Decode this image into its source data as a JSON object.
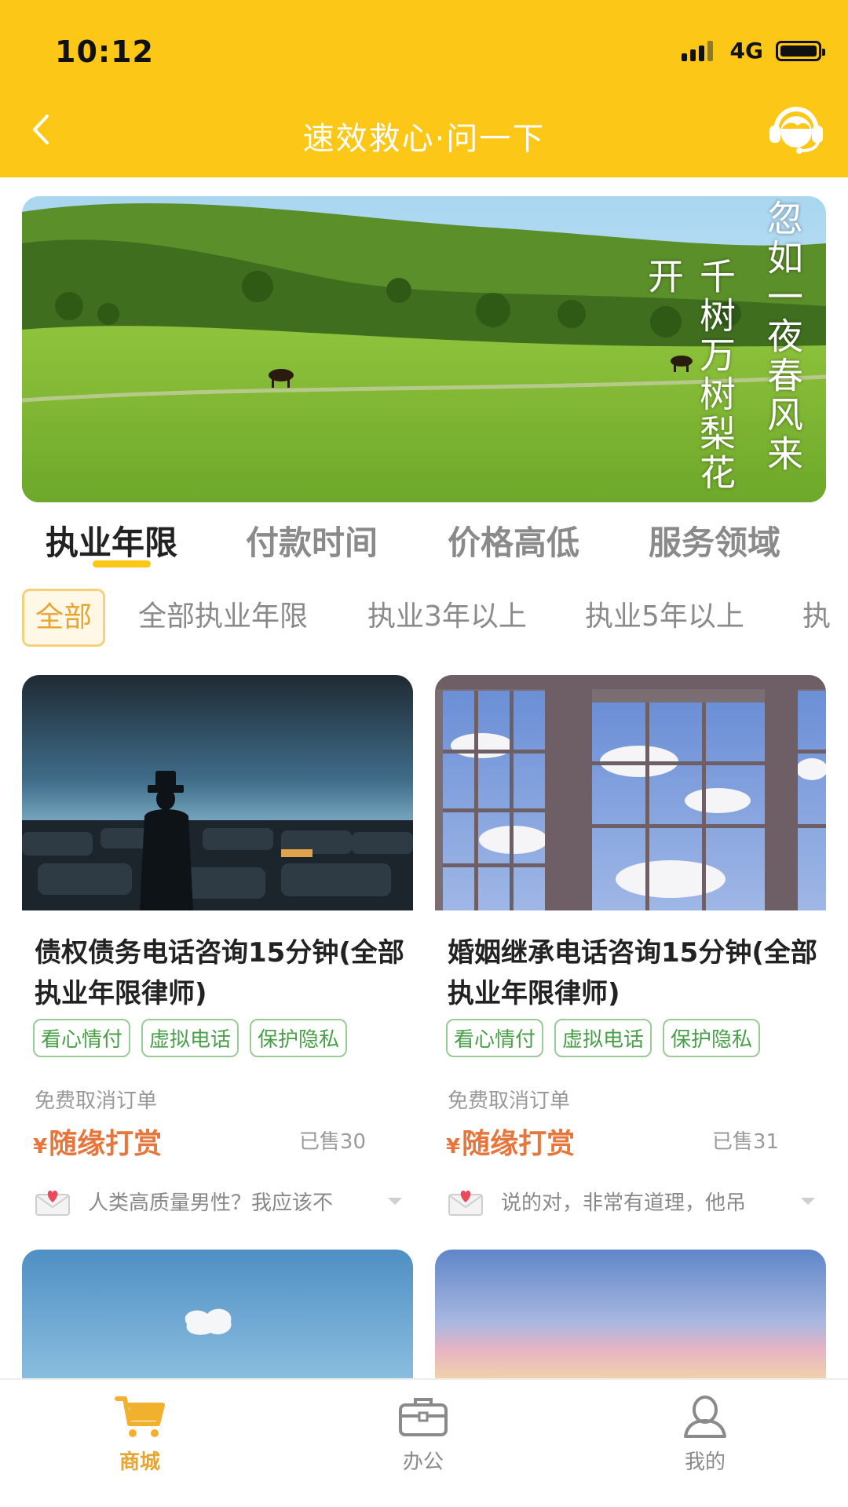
{
  "status_bar": {
    "time": "10:12",
    "network": "4G"
  },
  "header": {
    "title": "速效救心·问一下",
    "back_icon": "chevron-left-icon",
    "service_icon": "headset-icon"
  },
  "banner": {
    "poem_line_1": "忽如一夜春风来",
    "poem_line_2": "千树万树梨花开"
  },
  "sort_tabs": [
    {
      "label": "执业年限",
      "active": true
    },
    {
      "label": "付款时间",
      "active": false
    },
    {
      "label": "价格高低",
      "active": false
    },
    {
      "label": "服务领域",
      "active": false
    }
  ],
  "filters": [
    {
      "label": "全部",
      "active": true
    },
    {
      "label": "全部执业年限",
      "active": false
    },
    {
      "label": "执业3年以上",
      "active": false
    },
    {
      "label": "执业5年以上",
      "active": false
    },
    {
      "label": "执",
      "active": false
    }
  ],
  "products": [
    {
      "title": "债权债务电话咨询15分钟(全部执业年限律师)",
      "tags": [
        "看心情付",
        "虚拟电话",
        "保护隐私"
      ],
      "note": "免费取消订单",
      "currency": "¥",
      "price_text": "随缘打赏",
      "sold": "已售30",
      "review": "人类高质量男性？我应该不"
    },
    {
      "title": "婚姻继承电话咨询15分钟(全部执业年限律师)",
      "tags": [
        "看心情付",
        "虚拟电话",
        "保护隐私"
      ],
      "note": "免费取消订单",
      "currency": "¥",
      "price_text": "随缘打赏",
      "sold": "已售31",
      "review": "说的对，非常有道理，他吊"
    }
  ],
  "bottom_nav": [
    {
      "label": "商城",
      "icon": "cart-icon",
      "active": true
    },
    {
      "label": "办公",
      "icon": "briefcase-icon",
      "active": false
    },
    {
      "label": "我的",
      "icon": "user-icon",
      "active": false
    }
  ],
  "colors": {
    "brand_yellow": "#FCC716",
    "accent_orange": "#E7A531",
    "price_orange": "#E6763B",
    "tag_green": "#4a9f49"
  }
}
